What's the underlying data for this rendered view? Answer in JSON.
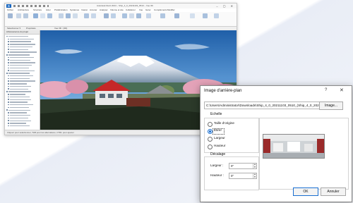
{
  "app": {
    "title": "Autodesk Revit 2024 – Ship_4_0_20211103_0510 – Vue 3D",
    "menu": [
      "Fichier",
      "Architecture",
      "Structure",
      "Acier",
      "Préfabrication",
      "Systèmes",
      "Insérer",
      "Annoter",
      "Analyser",
      "Volume et site",
      "Collaborer",
      "Vue",
      "Gérer",
      "Compléments",
      "Modifier"
    ],
    "subbar_items": [
      "Sélectionner ▾",
      "Propriétés",
      "Vue 3D : {3D}"
    ],
    "browser_title": "Arborescence du projet",
    "status_text": "Cliquez pour sélectionner, TAB pour les alternatives, CTRL pour ajouter"
  },
  "dialog": {
    "title": "Image d'arrière-plan",
    "help_label": "?",
    "close_label": "✕",
    "path_value": "C:\\Users\\Administrator\\Downloads\\Ship_4_0_20211103_0510_(Ship_4_0_20211103",
    "image_button": "Image...",
    "scale_label": "Echelle",
    "scale_options": [
      "Taille d'origine",
      "Etirer",
      "Largeur",
      "Hauteur"
    ],
    "offset_label": "Décalage",
    "offset_width_label": "Largeur :",
    "offset_width_value": "0\"",
    "offset_height_label": "Hauteur :",
    "offset_height_value": "0\"",
    "ok_label": "OK",
    "cancel_label": "Annuler"
  },
  "colors": {
    "accent": "#1a6fd1",
    "roof": "#c62828"
  }
}
